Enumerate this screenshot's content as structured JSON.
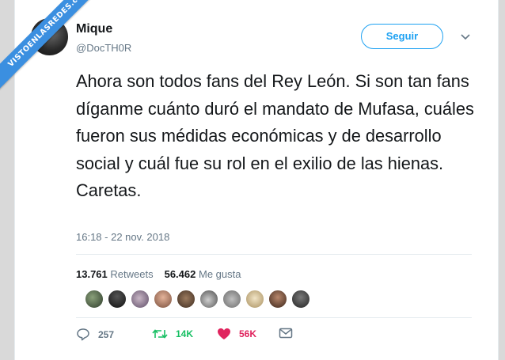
{
  "watermark": "VISTOENLASREDES.com",
  "author": {
    "name": "Mique",
    "handle": "@DocTH0R"
  },
  "follow_label": "Seguir",
  "tweet_text": "Ahora son todos fans del Rey León. Si son tan fans díganme cuánto duró el mandato de Mufasa, cuáles fueron sus médidas económicas y de desarrollo social y cuál fue su rol en el exilio de las hienas. Caretas.",
  "timestamp": "16:18 - 22 nov. 2018",
  "stats": {
    "retweets_count": "13.761",
    "retweets_label": "Retweets",
    "likes_count": "56.462",
    "likes_label": "Me gusta"
  },
  "actions": {
    "replies": "257",
    "retweets": "14K",
    "likes": "56K"
  },
  "colors": {
    "accent": "#1da1f2",
    "retweet": "#17bf63",
    "like": "#e0245e",
    "text": "#14171a",
    "secondary": "#657786",
    "ribbon": "#3b8fe0"
  },
  "icons": [
    "chevron-down-icon",
    "reply-icon",
    "retweet-icon",
    "heart-icon",
    "message-icon"
  ]
}
